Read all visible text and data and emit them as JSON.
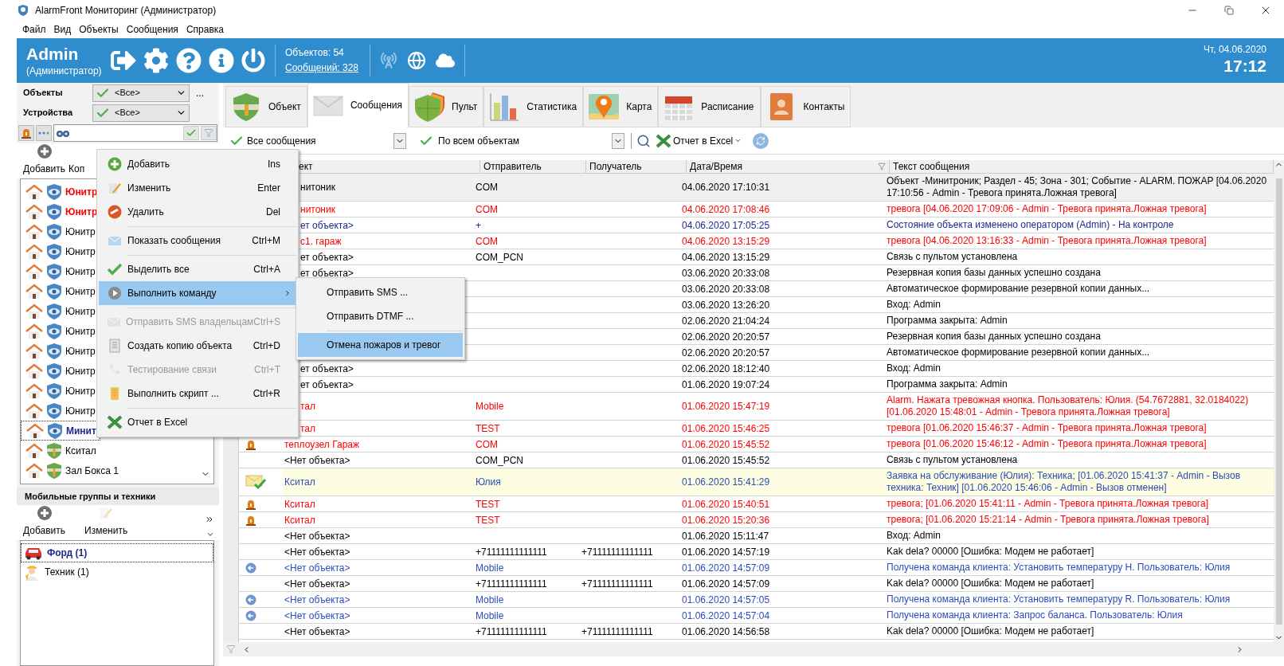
{
  "window": {
    "title": "AlarmFront Мониторинг (Администратор)"
  },
  "menu_bar": [
    "Файл",
    "Вид",
    "Объекты",
    "Сообщения",
    "Справка"
  ],
  "header": {
    "user": "Admin",
    "role": "(Администратор)",
    "objects": "Объектов: 54",
    "messages_link": "Сообщений: 328",
    "date": "Чт, 04.06.2020",
    "time": "17:12"
  },
  "left_panel": {
    "filters": [
      {
        "label": "Объекты",
        "value": "<Все>"
      },
      {
        "label": "Устройства",
        "value": "<Все>"
      }
    ],
    "more_button": "...",
    "toolbar": [
      "Добавить",
      "Коп"
    ],
    "objects": [
      {
        "label": "Юнитр",
        "kind": "eye",
        "alarm": true,
        "selected": false
      },
      {
        "label": "Юнитр",
        "kind": "eye",
        "alarm": true,
        "selected": false
      },
      {
        "label": "Юнитр",
        "kind": "eye",
        "alarm": false,
        "selected": false
      },
      {
        "label": "Юнитр",
        "kind": "eye",
        "alarm": false,
        "selected": false
      },
      {
        "label": "Юнитр",
        "kind": "eye",
        "alarm": false,
        "selected": false
      },
      {
        "label": "Юнитр",
        "kind": "eye",
        "alarm": false,
        "selected": false
      },
      {
        "label": "Юнитр",
        "kind": "eye",
        "alarm": false,
        "selected": false
      },
      {
        "label": "Юнитр",
        "kind": "eye",
        "alarm": false,
        "selected": false
      },
      {
        "label": "Юнитр",
        "kind": "eye",
        "alarm": false,
        "selected": false
      },
      {
        "label": "Юнитр",
        "kind": "eye",
        "alarm": false,
        "selected": false
      },
      {
        "label": "Юнитр",
        "kind": "eye",
        "alarm": false,
        "selected": false
      },
      {
        "label": "Юнитр",
        "kind": "eye",
        "alarm": false,
        "selected": false
      },
      {
        "label": "Минит",
        "kind": "eye",
        "alarm": false,
        "selected": true
      },
      {
        "label": "Кситал",
        "kind": "gate",
        "alarm": false,
        "selected": false
      },
      {
        "label": "Зал Бокса 1",
        "kind": "gate",
        "alarm": false,
        "selected": false
      }
    ],
    "mobile": {
      "title": "Мобильные группы и техники",
      "toolbar": [
        "Добавить",
        "Изменить"
      ],
      "items": [
        {
          "label": "Форд (1)",
          "kind": "car",
          "selected": true
        },
        {
          "label": "Техник (1)",
          "kind": "worker",
          "selected": false
        }
      ]
    }
  },
  "tabs": [
    {
      "label": "Объект",
      "selected": false
    },
    {
      "label": "Сообщения",
      "selected": true
    },
    {
      "label": "Пульт",
      "selected": false
    },
    {
      "label": "Статистика",
      "selected": false
    },
    {
      "label": "Карта",
      "selected": false
    },
    {
      "label": "Расписание",
      "selected": false
    },
    {
      "label": "Контакты",
      "selected": false
    }
  ],
  "toolbar": {
    "message_filter": "Все сообщения",
    "object_filter": "По всем объектам",
    "excel": "Отчет в Excel"
  },
  "table": {
    "columns": [
      {
        "label": "ект",
        "cut": true
      },
      {
        "label": "Отправитель"
      },
      {
        "label": "Получатель"
      },
      {
        "label": "Дата/Время"
      },
      {
        "label": "Текст сообщения"
      }
    ],
    "rows": [
      {
        "object": "нитоник",
        "cut": true,
        "sender": "COM",
        "datetime": "04.06.2020 17:10:31",
        "text": "Объект -Минитроник; Раздел - 45; Зона - 301; Событие - ALARM. ПОЖАР [04.06.2020 17:10:56 - Admin - Тревога принята.Ложная тревога]",
        "color": "#000000",
        "selected": true,
        "marked": false
      },
      {
        "object": "нитоник",
        "cut": true,
        "sender": "COM",
        "datetime": "04.06.2020 17:08:46",
        "text": "тревога [04.06.2020 17:09:06 - Admin - Тревога принята.Ложная тревога]",
        "color": "#ff0000",
        "selected": false,
        "marked": false
      },
      {
        "object": "ет объекта>",
        "cut": true,
        "sender": "+",
        "datetime": "04.06.2020 17:05:25",
        "text": "Состояние объекта изменено оператором (Admin) - На контроле",
        "color": "#1c2a8c",
        "selected": false,
        "marked": false
      },
      {
        "object": "с1. гараж",
        "cut": true,
        "sender": "COM",
        "datetime": "04.06.2020 13:15:29",
        "text": "тревога [04.06.2020 13:16:33 - Admin - Тревога принята.Ложная тревога]",
        "color": "#ff0000",
        "selected": false,
        "marked": false
      },
      {
        "object": "ет объекта>",
        "cut": true,
        "sender": "COM_PCN",
        "datetime": "04.06.2020 13:15:29",
        "text": "Связь с пультом установлена",
        "color": "#000000",
        "selected": false,
        "marked": false
      },
      {
        "object": "ет объекта>",
        "cut": true,
        "datetime": "03.06.2020 20:33:08",
        "text": "Резервная копия базы данных успешно создана",
        "color": "#000000",
        "selected": false,
        "marked": false
      },
      {
        "datetime": "03.06.2020 20:33:08",
        "text": "Автоматическое формирование резервной копии данных...",
        "color": "#000000",
        "selected": false,
        "marked": false
      },
      {
        "datetime": "03.06.2020 13:26:20",
        "text": "Вход: Admin",
        "color": "#000000",
        "selected": false,
        "marked": false
      },
      {
        "datetime": "02.06.2020 21:04:24",
        "text": "Программа закрыта: Admin",
        "color": "#000000",
        "selected": false,
        "marked": false
      },
      {
        "datetime": "02.06.2020 20:20:57",
        "text": "Резервная копия базы данных успешно создана",
        "color": "#000000",
        "selected": false,
        "marked": false
      },
      {
        "datetime": "02.06.2020 20:20:57",
        "text": "Автоматическое формирование резервной копии данных...",
        "color": "#000000",
        "selected": false,
        "marked": false
      },
      {
        "object": "ет объекта>",
        "cut": true,
        "datetime": "02.06.2020 18:12:40",
        "text": "Вход: Admin",
        "color": "#000000",
        "selected": false,
        "marked": false
      },
      {
        "object": "ет объекта>",
        "cut": true,
        "datetime": "01.06.2020 19:07:24",
        "text": "Программа закрыта: Admin",
        "color": "#000000",
        "selected": false,
        "marked": false
      },
      {
        "object": "тал",
        "cut": true,
        "sender": "Mobile",
        "datetime": "01.06.2020 15:47:19",
        "text": "Alarm. Нажата тревожная кнопка. Пользователь: Юлия. (54.7672881, 32.0184022) [01.06.2020 15:48:01 - Admin - Тревога принята.Ложная тревога]",
        "color": "#ff0000",
        "selected": false,
        "marked": false
      },
      {
        "object": "тал",
        "cut": true,
        "sender": "TEST",
        "datetime": "01.06.2020 15:46:25",
        "text": "тревога [01.06.2020 15:46:37 - Admin - Тревога принята.Ложная тревога]",
        "color": "#ff0000",
        "selected": false,
        "marked": false
      },
      {
        "kind": "siren",
        "object": "теплоузел Гараж",
        "cut": false,
        "sender": "COM",
        "datetime": "01.06.2020 15:45:52",
        "text": "тревога [01.06.2020 15:46:12 - Admin - Тревога принята.Ложная тревога]",
        "color": "#ff0000",
        "selected": false,
        "marked": false
      },
      {
        "object": "<Нет объекта>",
        "cut": false,
        "sender": "COM_PCN",
        "datetime": "01.06.2020 15:45:52",
        "text": "Связь с пультом установлена",
        "color": "#000000",
        "selected": false,
        "marked": false
      },
      {
        "kind": "mail_check",
        "object": "Кситал",
        "cut": false,
        "sender": "Юлия",
        "datetime": "01.06.2020 15:41:29",
        "text": "Заявка на обслуживание (Юлия): Техника;  [01.06.2020 15:41:37 - Admin - Вызов техника: Техник] [01.06.2020 15:46:06 - Admin - Вызов отменен]",
        "color": "#2b4cb8",
        "selected": false,
        "marked": true
      },
      {
        "kind": "siren",
        "object": "Кситал",
        "cut": false,
        "sender": "TEST",
        "datetime": "01.06.2020 15:40:51",
        "text": "тревога;  [01.06.2020 15:41:11 - Admin - Тревога принята.Ложная тревога]",
        "color": "#ff0000",
        "selected": false,
        "marked": false
      },
      {
        "kind": "siren",
        "object": "Кситал",
        "cut": false,
        "sender": "TEST",
        "datetime": "01.06.2020 15:20:36",
        "text": "тревога;  [01.06.2020 15:21:14 - Admin - Тревога принята.Ложная тревога]",
        "color": "#ff0000",
        "selected": false,
        "marked": false
      },
      {
        "object": "<Нет объекта>",
        "cut": false,
        "datetime": "01.06.2020 15:11:47",
        "text": "Вход: Admin",
        "color": "#000000",
        "selected": false,
        "marked": false
      },
      {
        "object": "<Нет объекта>",
        "cut": false,
        "sender": "+71111111111111",
        "recipient": "+71111111111111",
        "datetime": "01.06.2020 14:57:19",
        "text": "Kak dela? 00000 [Ошибка: Модем не работает]",
        "color": "#000000",
        "selected": false,
        "marked": false
      },
      {
        "kind": "incoming",
        "object": "<Нет объекта>",
        "cut": false,
        "sender": "Mobile",
        "datetime": "01.06.2020 14:57:09",
        "text": "Получена команда клиента: Установить температуру H. Пользователь: Юлия",
        "color": "#2b4cb8",
        "selected": false,
        "marked": false
      },
      {
        "object": "<Нет объекта>",
        "cut": false,
        "sender": "+71111111111111",
        "recipient": "+71111111111111",
        "datetime": "01.06.2020 14:57:09",
        "text": "Kak dela? 00000 [Ошибка: Модем не работает]",
        "color": "#000000",
        "selected": false,
        "marked": false
      },
      {
        "kind": "incoming",
        "object": "<Нет объекта>",
        "cut": false,
        "sender": "Mobile",
        "datetime": "01.06.2020 14:57:05",
        "text": "Получена команда клиента: Установить температуру R. Пользователь: Юлия",
        "color": "#2b4cb8",
        "selected": false,
        "marked": false
      },
      {
        "kind": "incoming",
        "object": "<Нет объекта>",
        "cut": false,
        "sender": "Mobile",
        "datetime": "01.06.2020 14:57:04",
        "text": "Получена команда клиента: Запрос баланса. Пользователь: Юлия",
        "color": "#2b4cb8",
        "selected": false,
        "marked": false
      },
      {
        "object": "<Нет объекта>",
        "cut": false,
        "sender": "+71111111111111",
        "recipient": "+71111111111111",
        "datetime": "01.06.2020 14:56:58",
        "text": "Kak dela? 00000 [Ошибка: Модем не работает]",
        "color": "#000000",
        "selected": false,
        "marked": false
      }
    ]
  },
  "context_menu": {
    "items": [
      {
        "kind": "item",
        "label": "Добавить",
        "shortcut": "Ins",
        "disabled": false,
        "selected": false,
        "submenu": false
      },
      {
        "kind": "item",
        "label": "Изменить",
        "shortcut": "Enter",
        "disabled": false,
        "selected": false,
        "submenu": false
      },
      {
        "kind": "item",
        "label": "Удалить",
        "shortcut": "Del",
        "disabled": false,
        "selected": false,
        "submenu": false
      },
      {
        "kind": "separator"
      },
      {
        "kind": "item",
        "label": "Показать сообщения",
        "shortcut": "Ctrl+M",
        "disabled": false,
        "selected": false,
        "submenu": false
      },
      {
        "kind": "separator"
      },
      {
        "kind": "item",
        "label": "Выделить все",
        "shortcut": "Ctrl+A",
        "disabled": false,
        "selected": false,
        "submenu": false
      },
      {
        "kind": "item",
        "label": "Выполнить команду",
        "disabled": false,
        "selected": true,
        "submenu": true
      },
      {
        "kind": "separator"
      },
      {
        "kind": "item",
        "label": "Отправить SMS владельцам",
        "shortcut": "Ctrl+S",
        "disabled": true,
        "selected": false,
        "submenu": false
      },
      {
        "kind": "item",
        "label": "Создать копию объекта",
        "shortcut": "Ctrl+D",
        "disabled": false,
        "selected": false,
        "submenu": false
      },
      {
        "kind": "item",
        "label": "Тестирование связи",
        "shortcut": "Ctrl+T",
        "disabled": true,
        "selected": false,
        "submenu": false
      },
      {
        "kind": "item",
        "label": "Выполнить скрипт ...",
        "shortcut": "Ctrl+R",
        "disabled": false,
        "selected": false,
        "submenu": false
      },
      {
        "kind": "separator"
      },
      {
        "kind": "item",
        "label": "Отчет в Excel",
        "disabled": false,
        "selected": false
      }
    ],
    "submenu": [
      {
        "kind": "item",
        "label": "Отправить SMS ...",
        "selected": false
      },
      {
        "kind": "item",
        "label": "Отправить DTMF ...",
        "selected": false
      },
      {
        "kind": "separator"
      },
      {
        "kind": "item",
        "label": "Отмена пожаров и тревог",
        "selected": true
      }
    ]
  }
}
